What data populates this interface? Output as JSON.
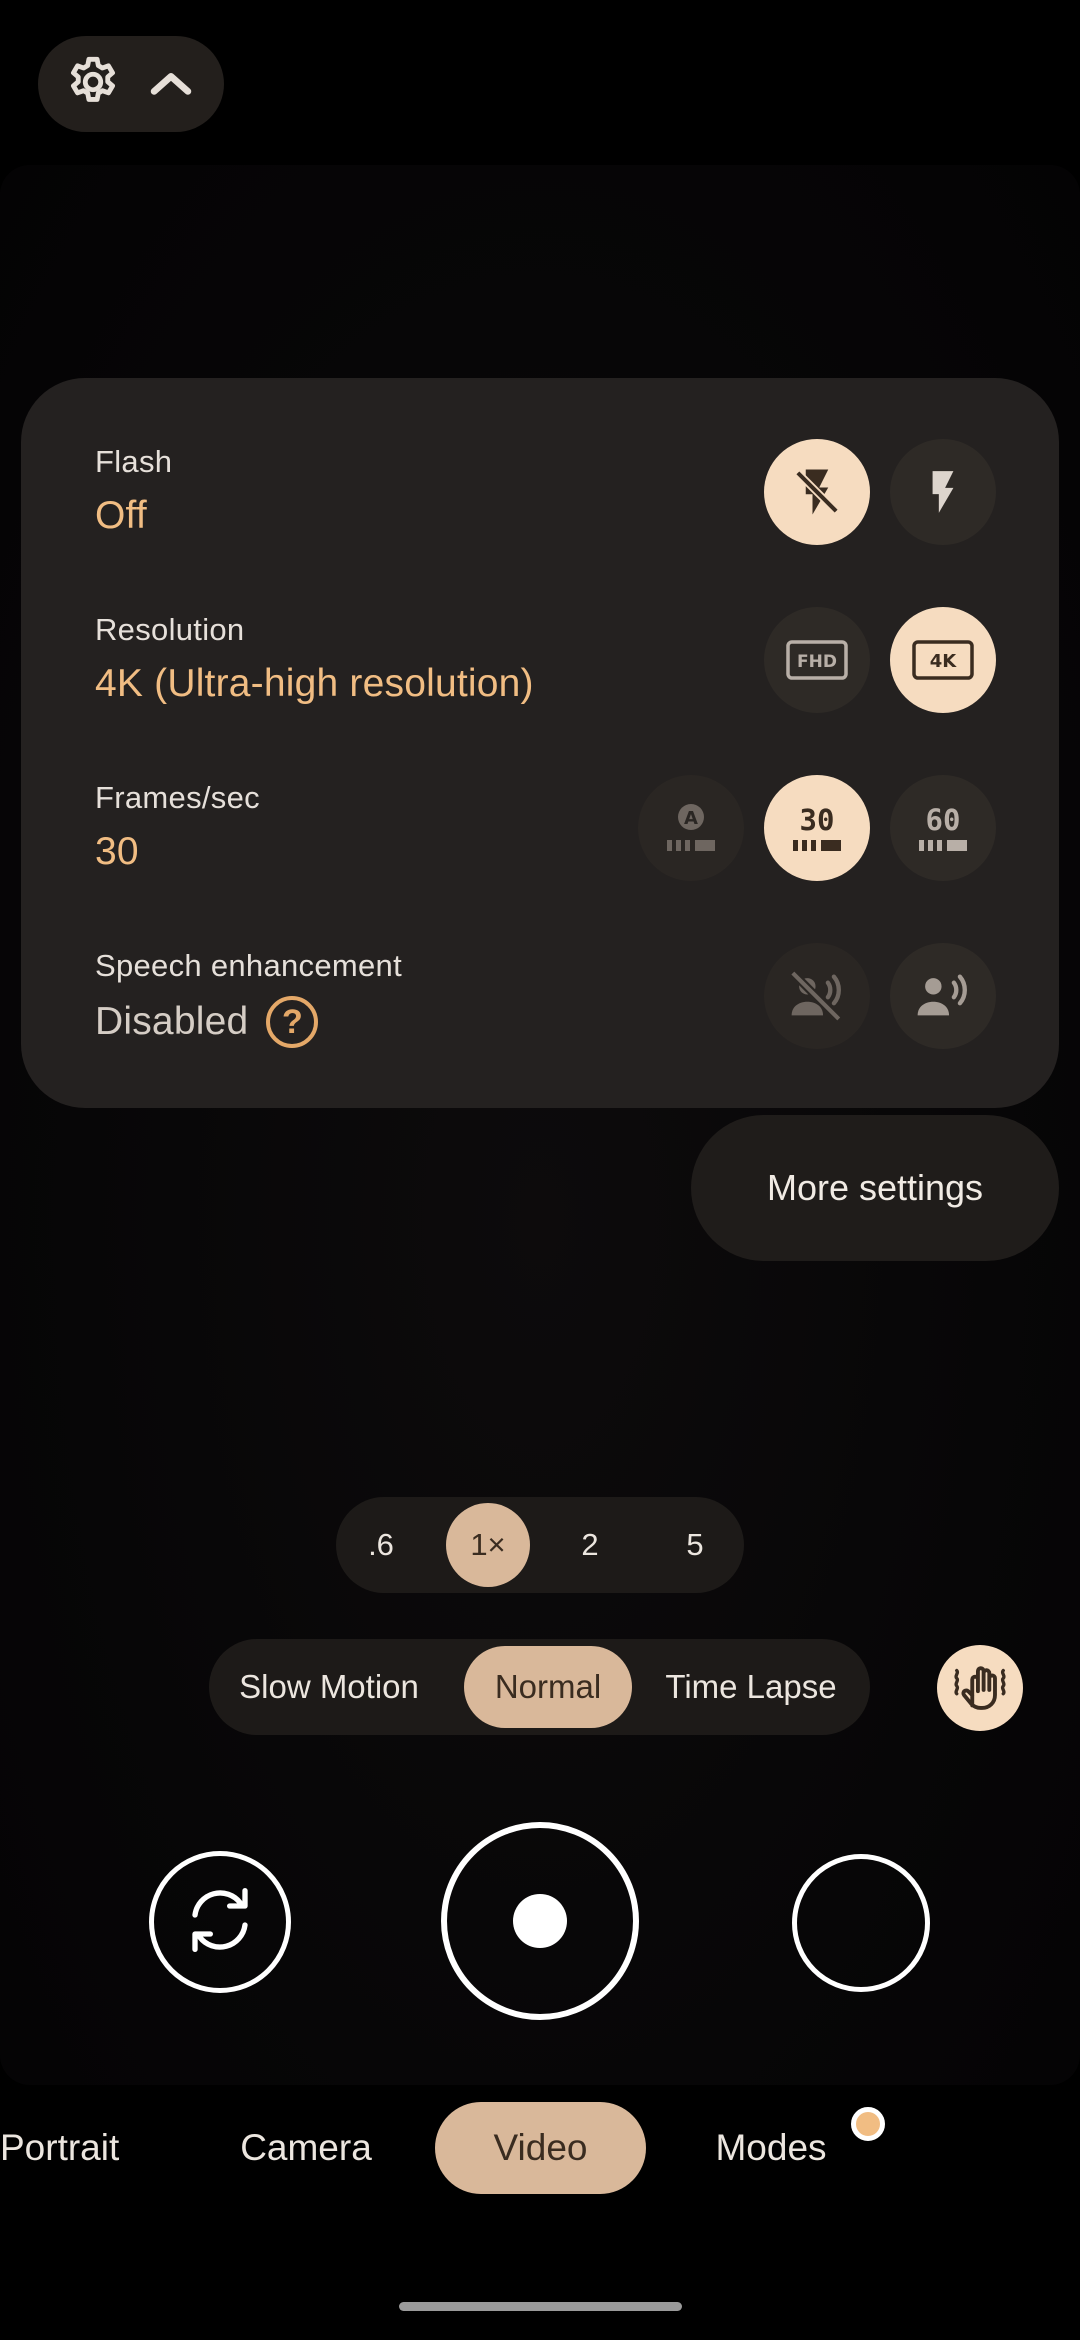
{
  "top_bar": {
    "settings_icon": "gear-icon",
    "collapse_icon": "chevron-up-icon"
  },
  "quick_settings": {
    "flash": {
      "label": "Flash",
      "value": "Off",
      "options": [
        "flash-off-icon",
        "flash-on-icon"
      ],
      "selected": "flash-off-icon"
    },
    "resolution": {
      "label": "Resolution",
      "value": "4K (Ultra-high resolution)",
      "options": [
        "FHD",
        "4K"
      ],
      "selected": "4K"
    },
    "fps": {
      "label": "Frames/sec",
      "value": "30",
      "options": [
        "A",
        "30",
        "60"
      ],
      "selected": "30"
    },
    "speech": {
      "label": "Speech enhancement",
      "value": "Disabled",
      "help_icon": "help-circle-icon",
      "help_glyph": "?",
      "options": [
        "speech-off-icon",
        "speech-on-icon"
      ],
      "selected": "speech-off-icon"
    }
  },
  "more_settings_label": "More settings",
  "zoom": {
    "options": [
      ".6",
      "1×",
      "2",
      "5"
    ],
    "selected": "1×"
  },
  "speed": {
    "options": [
      "Slow Motion",
      "Normal",
      "Time Lapse"
    ],
    "selected": "Normal",
    "stabilization_icon": "stabilization-hand-icon"
  },
  "capture": {
    "flip_icon": "flip-camera-icon",
    "shutter_icon": "record-icon",
    "gallery_icon": "gallery-thumbnail"
  },
  "modes": {
    "items": [
      "Portrait",
      "Camera",
      "Video",
      "Modes"
    ],
    "selected": "Video",
    "notification_dot": "notification-dot"
  },
  "colors": {
    "accent": "#f1bd83",
    "selected_chip": "#f6dcc0",
    "selected_pill": "#d9b89a",
    "panel": "#242120"
  }
}
